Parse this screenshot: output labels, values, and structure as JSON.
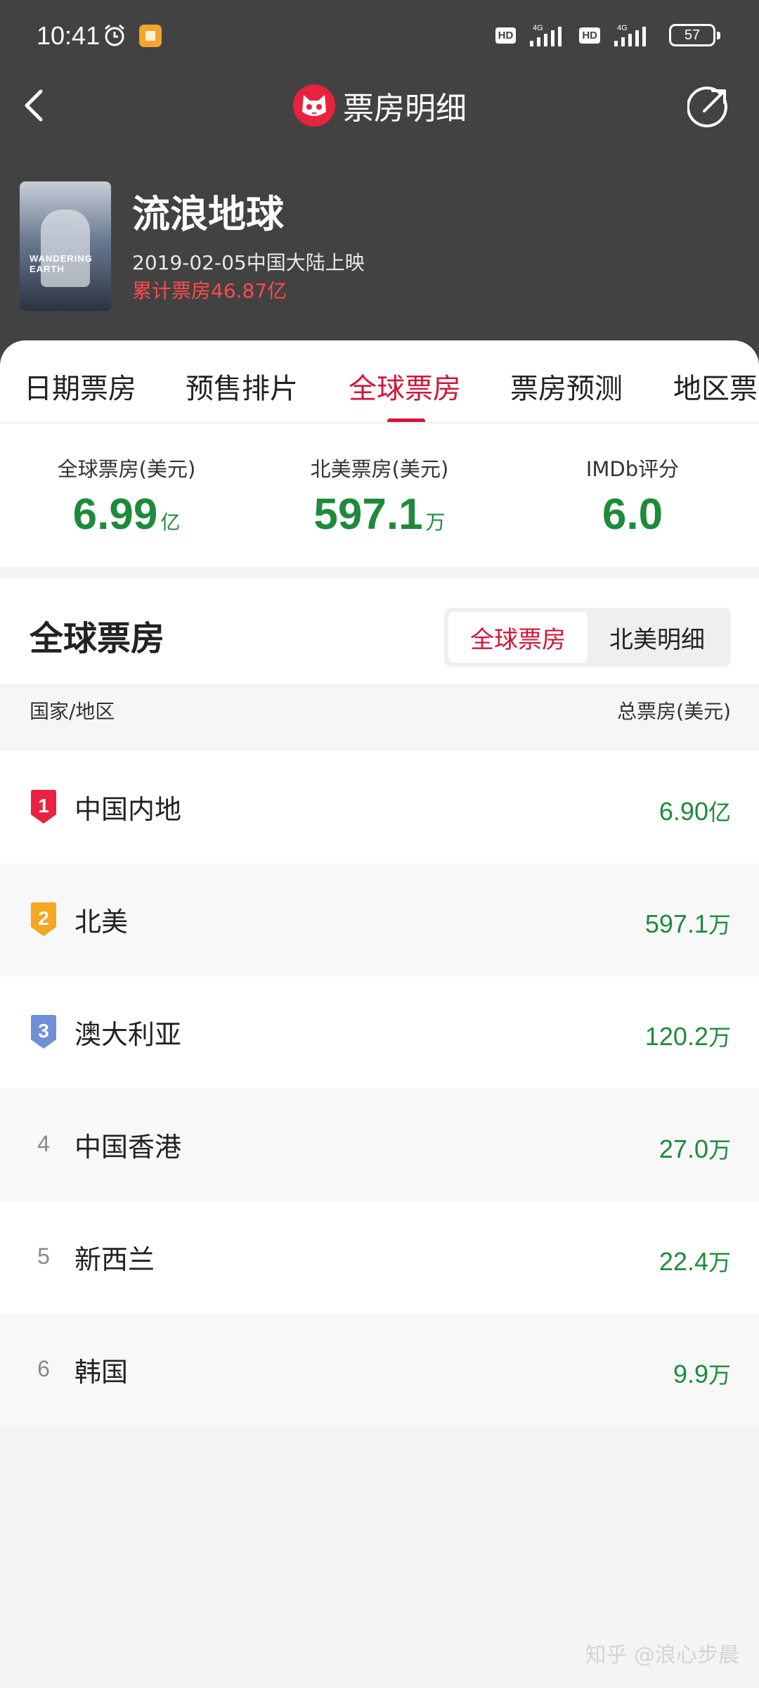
{
  "status_bar": {
    "time": "10:41",
    "hd1": "HD",
    "net1": "4G",
    "hd2": "HD",
    "net2": "4G",
    "battery": "57"
  },
  "nav": {
    "title": "票房明细"
  },
  "movie": {
    "title": "流浪地球",
    "poster_text": "WANDERING EARTH",
    "release": "2019-02-05中国大陆上映",
    "total": "累计票房46.87亿"
  },
  "tabs": [
    {
      "label": "日期票房"
    },
    {
      "label": "预售排片"
    },
    {
      "label": "全球票房"
    },
    {
      "label": "票房预测"
    },
    {
      "label": "地区票"
    }
  ],
  "active_tab": "全球票房",
  "stats": [
    {
      "label": "全球票房(美元)",
      "value": "6.99",
      "unit": "亿"
    },
    {
      "label": "北美票房(美元)",
      "value": "597.1",
      "unit": "万"
    },
    {
      "label": "IMDb评分",
      "value": "6.0",
      "unit": ""
    }
  ],
  "section": {
    "title": "全球票房",
    "toggle": [
      {
        "label": "全球票房"
      },
      {
        "label": "北美明细"
      }
    ],
    "col_region": "国家/地区",
    "col_total": "总票房(美元)"
  },
  "rows": [
    {
      "rank": "1",
      "region": "中国内地",
      "value": "6.90",
      "unit": "亿"
    },
    {
      "rank": "2",
      "region": "北美",
      "value": "597.1",
      "unit": "万"
    },
    {
      "rank": "3",
      "region": "澳大利亚",
      "value": "120.2",
      "unit": "万"
    },
    {
      "rank": "4",
      "region": "中国香港",
      "value": "27.0",
      "unit": "万"
    },
    {
      "rank": "5",
      "region": "新西兰",
      "value": "22.4",
      "unit": "万"
    },
    {
      "rank": "6",
      "region": "韩国",
      "value": "9.9",
      "unit": "万"
    }
  ],
  "rank_colors": {
    "1": "#e8223f",
    "2": "#f5a623",
    "3": "#6f8fd6"
  },
  "colors": {
    "accent": "#d0163a",
    "positive": "#1e8a3c",
    "header_bg": "#424242"
  },
  "watermark": "知乎 @浪心步晨"
}
